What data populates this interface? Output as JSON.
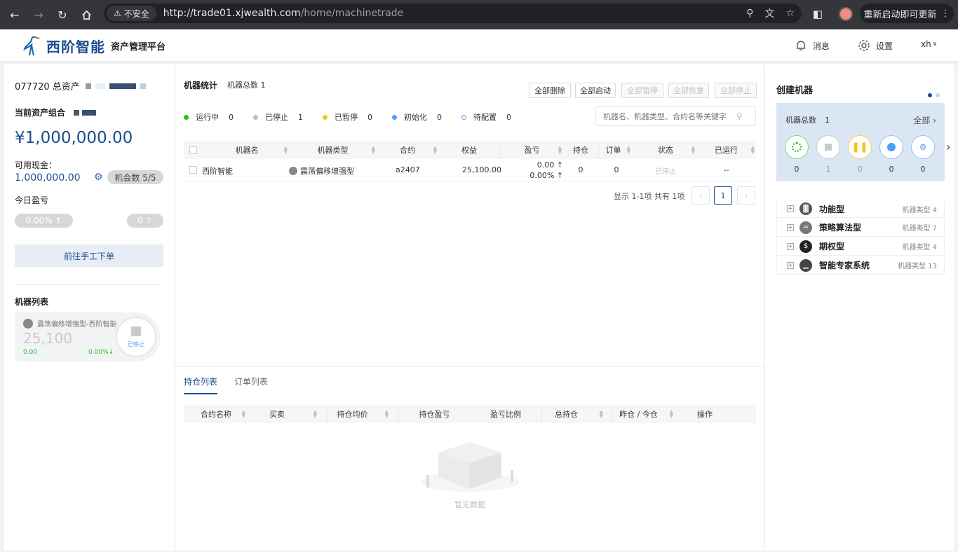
{
  "browser": {
    "insecure_label": "不安全",
    "url_host": "http://trade01.xjwealth.com",
    "url_path": "/home/machinetrade",
    "update_label": "重新启动即可更新"
  },
  "header": {
    "brand": "西阶智能",
    "platform": "资产管理平台",
    "messages_label": "消息",
    "settings_label": "设置",
    "user": "xh"
  },
  "account": {
    "id_label": "077720 总资产",
    "portfolio_label": "当前资产组合",
    "total_assets": "¥1,000,000.00",
    "cash_label": "可用现金：",
    "cash_value": "1,000,000.00",
    "chance_label": "机会数 5/5",
    "today_pnl_label": "今日盈亏",
    "pnl_percent": "0.00% ↑",
    "pnl_value": "0 ↑",
    "manual_order_label": "前往手工下单",
    "machine_list_label": "机器列表"
  },
  "machine_card": {
    "name": "震荡偏移增强型-西阶智能",
    "equity": "25,100",
    "pnl": "0.00",
    "pnl_pct": "0.00%↓",
    "status": "已停止"
  },
  "stats": {
    "title": "机器统计",
    "total_label": "机器总数 1",
    "buttons": [
      "全部删除",
      "全部启动",
      "全部暂停",
      "全部恢复",
      "全部停止"
    ],
    "statuses": [
      {
        "label": "运行中",
        "count": "0",
        "color": "#1ec31e"
      },
      {
        "label": "已停止",
        "count": "1",
        "color": "#c0c0c0"
      },
      {
        "label": "已暂停",
        "count": "0",
        "color": "#f5c518"
      },
      {
        "label": "初始化",
        "count": "0",
        "color": "#4a9ff5"
      },
      {
        "label": "待配置",
        "count": "0",
        "color": "#4a9ff5"
      }
    ],
    "search_placeholder": "机器名、机器类型、合约名等关键字"
  },
  "machine_table": {
    "headers": [
      "机器名",
      "机器类型",
      "合约",
      "权益",
      "盈亏",
      "持仓",
      "订单",
      "状态",
      "已运行"
    ],
    "row": {
      "name": "西阶智能",
      "type": "震荡偏移增强型",
      "contract": "a2407",
      "equity": "25,100.00",
      "pnl": "0.00 ↑",
      "pnl_pct": "0.00% ↑",
      "position": "0",
      "orders": "0",
      "status": "已停止",
      "runtime": "--"
    },
    "pagination_info": "显示 1-1项 共有 1项",
    "current_page": "1"
  },
  "tabs": {
    "positions": "持仓列表",
    "orders": "订单列表"
  },
  "position_table": {
    "headers": [
      "合约名称",
      "买卖",
      "持仓均价",
      "持仓盈亏",
      "盈亏比例",
      "总持仓",
      "昨仓 / 今仓",
      "操作"
    ],
    "empty_text": "暂无数据"
  },
  "create": {
    "title": "创建机器",
    "total_label": "机器总数",
    "total_value": "1",
    "all_label": "全部",
    "counts": [
      "0",
      "1",
      "0",
      "0",
      "0"
    ],
    "categories": [
      {
        "name": "功能型",
        "count": "机器类型 4"
      },
      {
        "name": "策略算法型",
        "count": "机器类型 7"
      },
      {
        "name": "期权型",
        "count": "机器类型 4"
      },
      {
        "name": "智能专家系统",
        "count": "机器类型 13"
      }
    ]
  }
}
